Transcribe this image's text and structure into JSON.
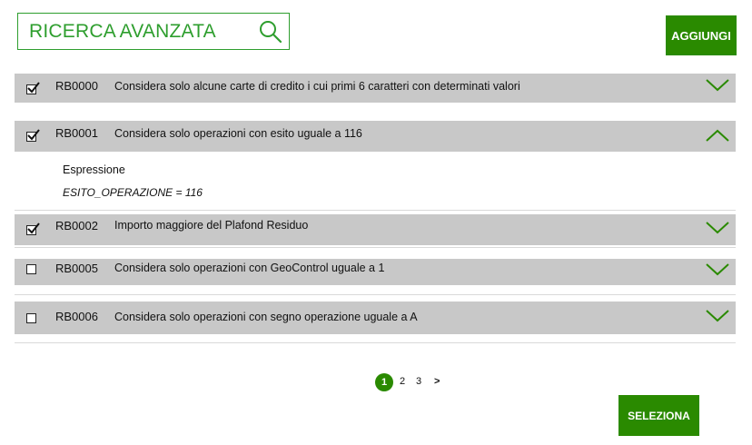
{
  "search": {
    "label": "RICERCA AVANZATA",
    "icon": "search-icon"
  },
  "toolbar": {
    "add_label": "AGGIUNGI",
    "select_label": "SELEZIONA"
  },
  "accent_color": "#2a8a00",
  "rules": [
    {
      "code": "RB0000",
      "description": "Considera solo alcune carte di credito i cui primi 6 caratteri con determinati valori",
      "checked": true,
      "expanded": false
    },
    {
      "code": "RB0001",
      "description": "Considera solo operazioni con esito uguale a 116",
      "checked": true,
      "expanded": true,
      "detail": {
        "label": "Espressione",
        "expression": "ESITO_OPERAZIONE = 116"
      }
    },
    {
      "code": "RB0002",
      "description": "Importo maggiore del Plafond Residuo",
      "checked": true,
      "expanded": false
    },
    {
      "code": "RB0005",
      "description": "Considera solo operazioni con GeoControl uguale a 1",
      "checked": false,
      "expanded": false
    },
    {
      "code": "RB0006",
      "description": "Considera solo operazioni con segno operazione uguale a A",
      "checked": false,
      "expanded": false
    }
  ],
  "pagination": {
    "current": "1",
    "pages": [
      "2",
      "3"
    ],
    "next": ">"
  }
}
